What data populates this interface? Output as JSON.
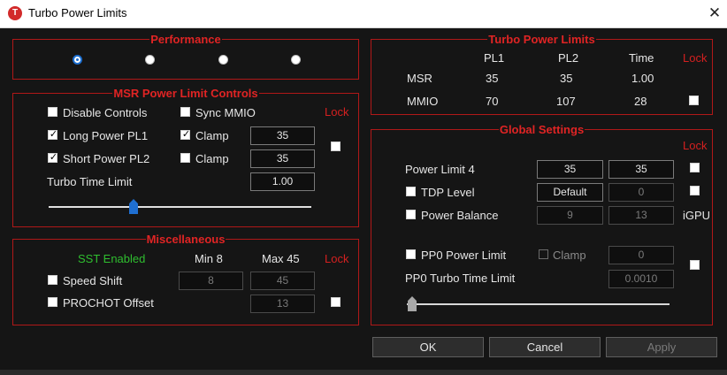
{
  "window": {
    "title": "Turbo Power Limits",
    "logo_letter": "T"
  },
  "performance": {
    "title": "Performance",
    "selected_index": 0,
    "options_count": 4
  },
  "msr": {
    "title": "MSR Power Limit Controls",
    "lock_label": "Lock",
    "disable_controls": {
      "label": "Disable Controls",
      "checked": false
    },
    "sync_mmio": {
      "label": "Sync MMIO",
      "checked": false
    },
    "long_pl1": {
      "label": "Long Power PL1",
      "checked": true,
      "value": "35",
      "clamp_label": "Clamp",
      "clamp_checked": true
    },
    "short_pl2": {
      "label": "Short Power PL2",
      "checked": true,
      "value": "35",
      "clamp_label": "Clamp",
      "clamp_checked": false
    },
    "turbo_time": {
      "label": "Turbo Time Limit",
      "value": "1.00",
      "slider_fraction": 0.39
    },
    "lock_checked": false
  },
  "misc": {
    "title": "Miscellaneous",
    "sst": "SST Enabled",
    "min_label": "Min",
    "min_value": "8",
    "max_label": "Max",
    "max_value": "45",
    "lock_label": "Lock",
    "speed_shift": {
      "label": "Speed Shift",
      "checked": false,
      "min": "8",
      "max": "45"
    },
    "prochot": {
      "label": "PROCHOT Offset",
      "checked": false,
      "value": "13"
    },
    "lock_checked": false
  },
  "turbo": {
    "title": "Turbo Power Limits",
    "headers": {
      "pl1": "PL1",
      "pl2": "PL2",
      "time": "Time",
      "lock": "Lock"
    },
    "rows": [
      {
        "name": "MSR",
        "pl1": "35",
        "pl2": "35",
        "time": "1.00"
      },
      {
        "name": "MMIO",
        "pl1": "70",
        "pl2": "107",
        "time": "28"
      }
    ],
    "mmio_lock_checked": false
  },
  "global": {
    "title": "Global Settings",
    "lock_label": "Lock",
    "power_limit4": {
      "label": "Power Limit 4",
      "v1": "35",
      "v2": "35"
    },
    "tdp_level": {
      "label": "TDP Level",
      "checked": false,
      "v1": "Default",
      "v2": "0"
    },
    "power_balance": {
      "label": "Power Balance",
      "checked": false,
      "v1": "9",
      "v2": "13",
      "suffix": "iGPU"
    },
    "pp0": {
      "label": "PP0 Power Limit",
      "checked": false,
      "clamp_label": "Clamp",
      "value": "0"
    },
    "pp0_turbo": {
      "label": "PP0 Turbo Time Limit",
      "value": "0.0010",
      "slider_fraction": 0.0
    }
  },
  "buttons": {
    "ok": "OK",
    "cancel": "Cancel",
    "apply": "Apply"
  }
}
